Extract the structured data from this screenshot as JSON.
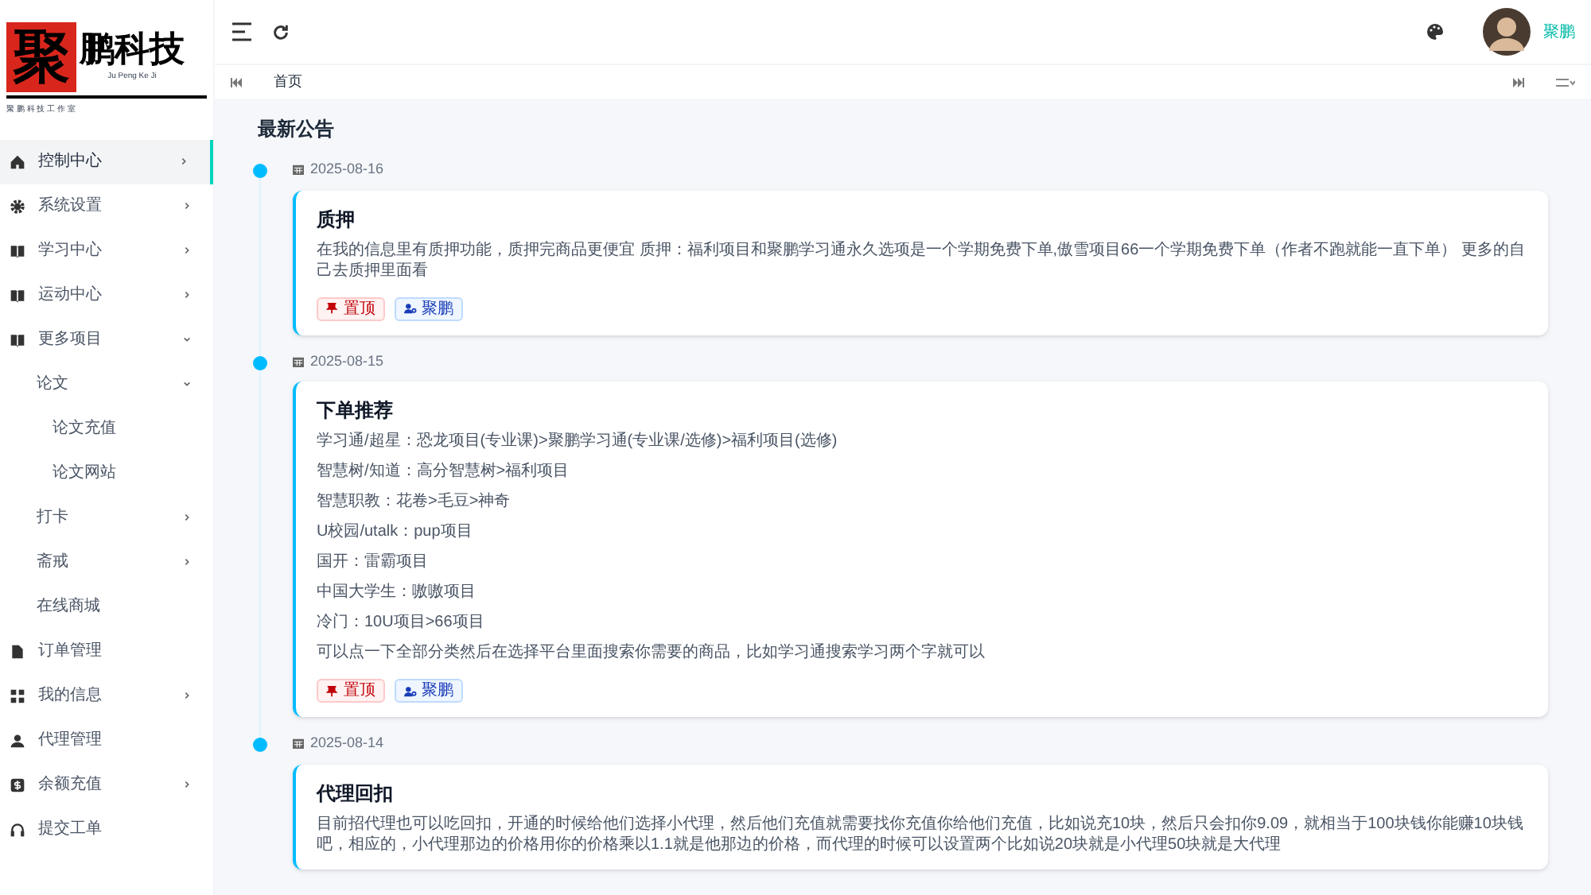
{
  "logo": {
    "mark": "聚",
    "name": "鹏科技",
    "pinyin": "Ju Peng Ke Ji",
    "studio": "聚 鹏 科 技 工 作 室"
  },
  "sidebar": {
    "items": [
      {
        "label": "控制中心",
        "kind": "home",
        "expanded": false,
        "selected": true
      },
      {
        "label": "系统设置",
        "kind": "gear",
        "expanded": false,
        "selected": false
      },
      {
        "label": "学习中心",
        "kind": "book",
        "expanded": false,
        "selected": false
      },
      {
        "label": "运动中心",
        "kind": "book",
        "expanded": false,
        "selected": false
      },
      {
        "label": "更多项目",
        "kind": "book",
        "expanded": true,
        "selected": false,
        "children": [
          {
            "label": "论文",
            "expanded": true,
            "selected": false,
            "children": [
              {
                "label": "论文充值",
                "selected": false
              },
              {
                "label": "论文网站",
                "selected": false
              }
            ]
          },
          {
            "label": "打卡",
            "expanded": false,
            "selected": false
          },
          {
            "label": "斋戒",
            "expanded": false,
            "selected": false
          },
          {
            "label": "在线商城",
            "selected": false
          }
        ]
      },
      {
        "label": "订单管理",
        "kind": "file",
        "selected": false
      },
      {
        "label": "我的信息",
        "kind": "grid",
        "expanded": false,
        "selected": false
      },
      {
        "label": "代理管理",
        "kind": "user",
        "selected": false
      },
      {
        "label": "余额充值",
        "kind": "dollar",
        "expanded": false,
        "selected": false
      },
      {
        "label": "提交工单",
        "kind": "headset",
        "selected": false
      }
    ]
  },
  "header": {
    "user": "聚鹏"
  },
  "tabs": [
    {
      "label": "首页",
      "selected": true
    }
  ],
  "page_title": "最新公告",
  "notices": [
    {
      "date": "2025-08-16",
      "title": "质押",
      "lines": [
        "在我的信息里有质押功能，质押完商品更便宜 质押：福利项目和聚鹏学习通永久选项是一个学期免费下单,傲雪项目66一个学期免费下单（作者不跑就能一直下单） 更多的自己去质押里面看"
      ],
      "tags": [
        {
          "label": "置顶",
          "kind": "pin"
        },
        {
          "label": "聚鹏",
          "kind": "author"
        }
      ]
    },
    {
      "date": "2025-08-15",
      "title": "下单推荐",
      "lines": [
        "学习通/超星：恐龙项目(专业课)>聚鹏学习通(专业课/选修)>福利项目(选修)",
        "智慧树/知道：高分智慧树>福利项目",
        "智慧职教：花卷>毛豆>神奇",
        "U校园/utalk：pup项目",
        "国开：雷霸项目",
        "中国大学生：嗷嗷项目",
        "冷门：10U项目>66项目",
        "可以点一下全部分类然后在选择平台里面搜索你需要的商品，比如学习通搜索学习两个字就可以"
      ],
      "tags": [
        {
          "label": "置顶",
          "kind": "pin"
        },
        {
          "label": "聚鹏",
          "kind": "author"
        }
      ]
    },
    {
      "date": "2025-08-14",
      "title": "代理回扣",
      "lines": [
        "目前招代理也可以吃回扣，开通的时候给他们选择小代理，然后他们充值就需要找你充值你给他们充值，比如说充10块，然后只会扣你9.09，就相当于100块钱你能赚10块钱吧，相应的，小代理那边的价格用你的价格乘以1.1就是他那边的价格，而代理的时候可以设置两个比如说20块就是小代理50块就是大代理"
      ]
    }
  ]
}
